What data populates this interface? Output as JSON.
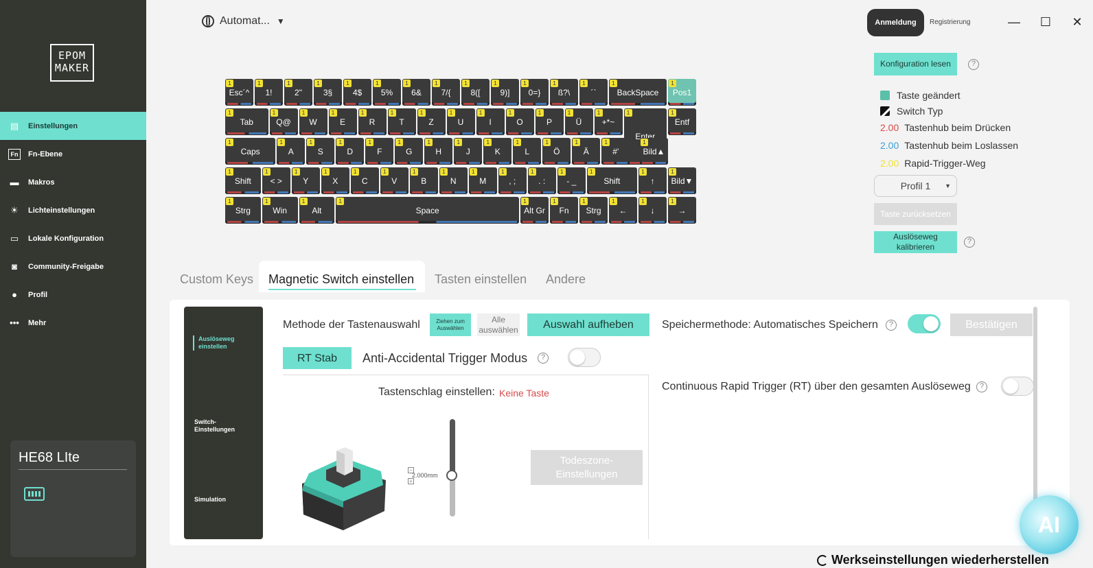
{
  "sidebar": {
    "logo_lines": [
      "EPOM",
      "MAKER"
    ],
    "items": [
      {
        "label": "Einstellungen",
        "icon": "settings-icon"
      },
      {
        "label": "Fn-Ebene",
        "icon": "fn-icon"
      },
      {
        "label": "Makros",
        "icon": "laptop-icon"
      },
      {
        "label": "Lichteinstellungen",
        "icon": "light-icon"
      },
      {
        "label": "Lokale Konfiguration",
        "icon": "archive-icon"
      },
      {
        "label": "Community-Freigabe",
        "icon": "chat-icon"
      },
      {
        "label": "Profil",
        "icon": "user-icon"
      },
      {
        "label": "Mehr",
        "icon": "more-icon"
      }
    ],
    "device_name": "HE68 LIte"
  },
  "topbar": {
    "language": "Automat...",
    "login": "Anmeldung",
    "register": "Registrierung"
  },
  "keyboard": {
    "rows": [
      [
        "Esc´^",
        "1!",
        "2\"",
        "3§",
        "4$",
        "5%",
        "6&",
        "7/{",
        "8([",
        "9)]",
        "0=}",
        "ß?\\",
        "´`",
        "BackSpace",
        "Pos1"
      ],
      [
        "Tab",
        "Q@",
        "W",
        "E",
        "R",
        "T",
        "Z",
        "U",
        "I",
        "O",
        "P",
        "Ü",
        "+*~",
        "Enter",
        "Entf"
      ],
      [
        "Caps",
        "A",
        "S",
        "D",
        "F",
        "G",
        "H",
        "J",
        "K",
        "L",
        "Ö",
        "Ä",
        "#'",
        "Bild▲"
      ],
      [
        "Shift",
        "< >",
        "Y",
        "X",
        "C",
        "V",
        "B",
        "N",
        "M",
        ", ;",
        ". :",
        "- _",
        "Shift",
        "↑",
        "Bild▼"
      ],
      [
        "Strg",
        "Win",
        "Alt",
        "Space",
        "Alt Gr",
        "Fn",
        "Strg",
        "←",
        "↓",
        "→"
      ]
    ],
    "badge": "1"
  },
  "right_panel": {
    "read_config": "Konfiguration lesen",
    "legend": {
      "changed": "Taste geändert",
      "switch_type": "Switch Typ",
      "press_value": "2.00",
      "press_label": "Tastenhub beim Drücken",
      "release_value": "2.00",
      "release_label": "Tastenhub beim Loslassen",
      "rt_value": "2.00",
      "rt_label": "Rapid-Trigger-Weg"
    },
    "profile": "Profil 1",
    "reset_key": "Taste zurücksetzen",
    "calibrate": "Auslöseweg kalibrieren",
    "colors": {
      "accent": "#6fe0cf",
      "changed": "#5cbfa8",
      "press": "#d94a4a",
      "release": "#3aa0d9",
      "rt": "#f2e233"
    }
  },
  "tabs": [
    "Custom Keys",
    "Magnetic Switch einstellen",
    "Tasten einstellen",
    "Andere"
  ],
  "subnav": [
    "Auslöseweg einstellen",
    "Switch- Einstellungen",
    "Simulation"
  ],
  "content": {
    "select_method_label": "Methode der Tastenauswahl",
    "drag_select": "Ziehen zum Auswählen",
    "select_all": "Alle auswählen",
    "deselect": "Auswahl aufheben",
    "save_method": "Speichermethode: Automatisches Speichern",
    "confirm": "Bestätigen",
    "rt_stab": "RT Stab",
    "anti_accidental": "Anti-Accidental Trigger Modus",
    "keystroke_label": "Tastenschlag einstellen:",
    "keystroke_value": "Keine Taste",
    "slider_value": "2.000mm",
    "deadzone": "Todeszone-Einstellungen",
    "continuous_rt": "Continuous Rapid Trigger (RT) über den gesamten Auslöseweg"
  },
  "ai_label": "AI",
  "restore": "Werkseinstellungen wiederherstellen"
}
